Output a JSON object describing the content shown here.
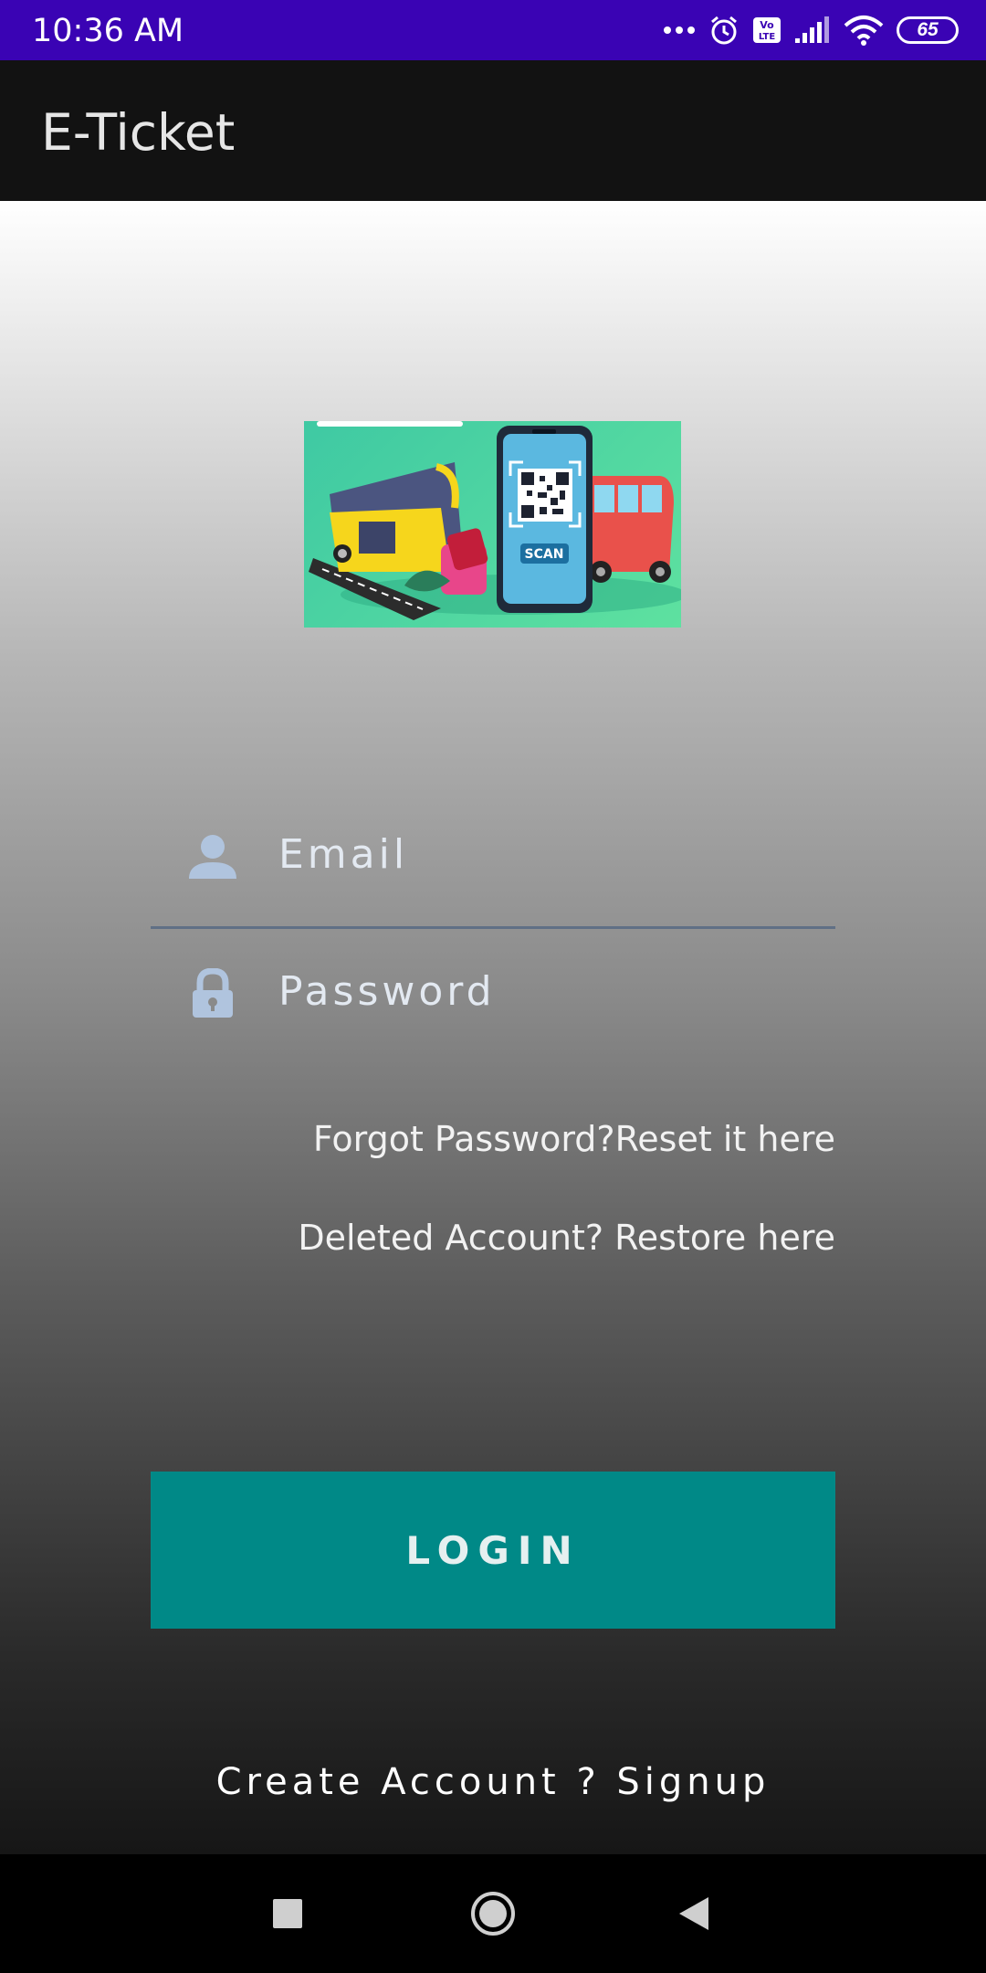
{
  "status_bar": {
    "time": "10:36 AM",
    "battery": "65",
    "icons": [
      "more-dots-icon",
      "alarm-icon",
      "volte-icon",
      "signal-icon",
      "wifi-icon",
      "battery-icon"
    ]
  },
  "app_bar": {
    "title": "E-Ticket"
  },
  "banner": {
    "scan_label": "SCAN"
  },
  "form": {
    "email_placeholder": "Email",
    "password_placeholder": "Password",
    "forgot_link": "Forgot Password?Reset it here",
    "restore_link": "Deleted Account? Restore here",
    "login_label": "LOGIN",
    "signup_link": "Create Account ? Signup"
  },
  "colors": {
    "status_bar": "#3a03b4",
    "app_bar": "#121212",
    "login_button": "#008987",
    "icon_tint": "#b0c4de"
  },
  "nav_bar": {
    "icons": [
      "recents-square-icon",
      "home-circle-icon",
      "back-triangle-icon"
    ]
  }
}
